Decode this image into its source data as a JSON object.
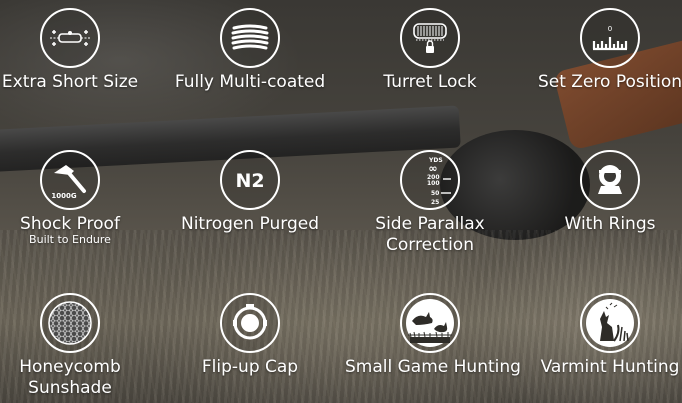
{
  "features": [
    {
      "label": "Extra Short Size",
      "icon": "compact-scope-icon"
    },
    {
      "label": "Fully Multi-coated",
      "icon": "lens-coating-icon"
    },
    {
      "label": "Turret Lock",
      "icon": "turret-lock-icon"
    },
    {
      "label": "Set Zero Position",
      "icon": "zero-scale-icon",
      "icon_text": "0"
    },
    {
      "label": "Shock Proof",
      "sublabel": "Built to Endure",
      "icon": "hammer-icon",
      "icon_text": "1000G"
    },
    {
      "label": "Nitrogen Purged",
      "icon": "nitrogen-icon",
      "icon_text": "N2"
    },
    {
      "label": "Side Parallax",
      "label2": "Correction",
      "icon": "parallax-dial-icon",
      "icon_text": {
        "unit": "YDS",
        "inf": "∞",
        "v200": "200",
        "v100": "100",
        "v50": "50",
        "v25": "25"
      }
    },
    {
      "label": "With Rings",
      "icon": "scope-ring-icon"
    },
    {
      "label": "Honeycomb",
      "label2": "Sunshade",
      "icon": "honeycomb-icon"
    },
    {
      "label": "Flip-up Cap",
      "icon": "flip-cap-icon"
    },
    {
      "label": "Small Game Hunting",
      "icon": "rabbit-icon"
    },
    {
      "label": "Varmint Hunting",
      "icon": "coyote-icon"
    }
  ]
}
